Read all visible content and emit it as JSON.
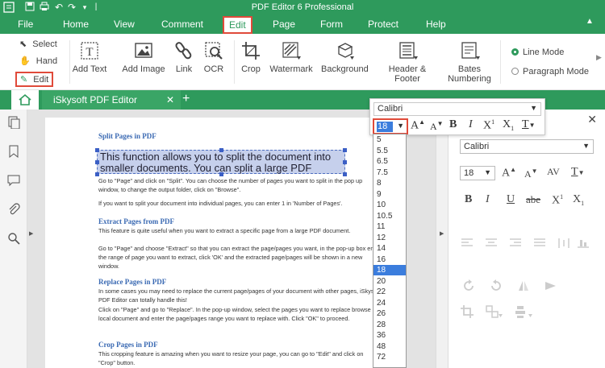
{
  "app": {
    "title": "PDF Editor 6 Professional"
  },
  "menu": [
    "File",
    "Home",
    "View",
    "Comment",
    "Edit",
    "Page",
    "Form",
    "Protect",
    "Help"
  ],
  "ribbon": {
    "select": "Select",
    "hand": "Hand",
    "edit": "Edit",
    "add_text": "Add Text",
    "add_image": "Add Image",
    "link": "Link",
    "ocr": "OCR",
    "crop": "Crop",
    "watermark": "Watermark",
    "background": "Background",
    "header_footer": "Header & Footer",
    "bates_1": "Bates",
    "bates_2": "Numbering",
    "line_mode": "Line Mode",
    "paragraph_mode": "Paragraph Mode"
  },
  "tab": {
    "doc_title": "iSkysoft PDF Editor"
  },
  "font_popup": {
    "font": "Calibri",
    "size": "18",
    "sizes": [
      "5",
      "5.5",
      "6.5",
      "7.5",
      "8",
      "9",
      "10",
      "10.5",
      "11",
      "12",
      "14",
      "16",
      "18",
      "20",
      "22",
      "24",
      "26",
      "28",
      "36",
      "48",
      "72"
    ]
  },
  "right_panel": {
    "font": "Calibri",
    "size": "18"
  },
  "document": {
    "h1": "Split Pages in PDF",
    "selected": "This function allows you to split the document into smaller documents. You can split a large PDF",
    "p1": "Go to \"Page\" and click on \"Split\". You can choose the number of pages you want to split in the pop up window, to change the output folder, click on \"Browse\".",
    "p2": "If you want to split your document into individual pages, you can enter 1 in 'Number of Pages'.",
    "h2": "Extract Pages from PDF",
    "p3": "This feature is quite useful when you want to extract a specific page from a large PDF document.",
    "p4": "Go to \"Page\" and choose \"Extract\" so that you can extract the page/pages you want, in the pop-up box enter the range of page you want to extract, click 'OK' and the extracted page/pages will be shown in a new window.",
    "h3": "Replace Pages in PDF",
    "p5": "In some cases you may need to replace the current page/pages of your document with other pages, iSkysoft PDF Editor can totally handle this!",
    "p6": "Click on \"Page\" and go to \"Replace\". In the pop-up window, select the pages you want to replace browse a local document and enter the page/pages range you want to replace with. Click \"OK\" to proceed.",
    "h4": "Crop Pages in PDF",
    "p7": "This cropping feature is amazing when you want to resize your page, you can go to \"Edit\" and click on \"Crop\" button."
  }
}
